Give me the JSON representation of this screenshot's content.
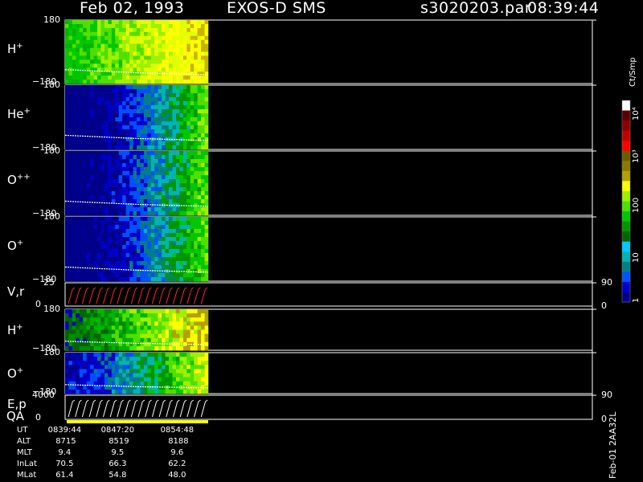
{
  "header": {
    "date": "Feb 02, 1993",
    "instrument": "EXOS-D SMS",
    "file": "s3020203.par",
    "time": "08:39:44"
  },
  "panels": [
    {
      "id": "p-hplus-1",
      "label": "H",
      "sup": "+",
      "ytop": "180",
      "ybot": "−180",
      "kind": "spec",
      "palette": "hplus"
    },
    {
      "id": "p-heplus",
      "label": "He",
      "sup": "+",
      "ytop": "180",
      "ybot": "−180",
      "kind": "spec",
      "palette": "cold"
    },
    {
      "id": "p-oplusplus",
      "label": "O",
      "sup": "++",
      "ytop": "180",
      "ybot": "−180",
      "kind": "spec",
      "palette": "cold"
    },
    {
      "id": "p-oplus-1",
      "label": "O",
      "sup": "+",
      "ytop": "180",
      "ybot": "−180",
      "kind": "spec",
      "palette": "cold"
    },
    {
      "id": "p-vr",
      "label": "V,r",
      "sup": "",
      "ytop": "25",
      "ybot": "0",
      "rtop": "90",
      "rbot": "0",
      "kind": "line",
      "color": "#ff2a2a"
    },
    {
      "id": "p-hplus-2",
      "label": "H",
      "sup": "+",
      "ytop": "180",
      "ybot": "−180",
      "kind": "spec",
      "palette": "hplus2"
    },
    {
      "id": "p-oplus-2",
      "label": "O",
      "sup": "+",
      "ytop": "180",
      "ybot": "−180",
      "kind": "spec",
      "palette": "cold2"
    },
    {
      "id": "p-ep",
      "label": "E,p",
      "sup": "",
      "ytop": "4000",
      "ybot": "0",
      "rtop": "90",
      "rbot": "0",
      "kind": "line",
      "color": "#ffffff"
    }
  ],
  "qa_label": "QA",
  "colorbar": {
    "title": "Ct/Smp",
    "ticks": [
      "1",
      "10",
      "100",
      "10³",
      "10⁴"
    ],
    "colors": [
      "#00008b",
      "#0000c8",
      "#0050ff",
      "#008080",
      "#00b4b4",
      "#00c8ff",
      "#006400",
      "#009600",
      "#00c800",
      "#50e000",
      "#a0f000",
      "#ffff00",
      "#b4a000",
      "#8c7800",
      "#6e5a00",
      "#ff0000",
      "#c00000",
      "#8b0000",
      "#5a0000",
      "#ffffff"
    ]
  },
  "ephemeris": {
    "rows": [
      {
        "label": "UT",
        "values": [
          "0839:44",
          "0847:20",
          "0854:48"
        ]
      },
      {
        "label": "ALT",
        "values": [
          "8715",
          "8519",
          "8188"
        ]
      },
      {
        "label": "MLT",
        "values": [
          "9.4",
          "9.5",
          "9.6"
        ]
      },
      {
        "label": "InLat",
        "values": [
          "70.5",
          "66.3",
          "62.2"
        ]
      },
      {
        "label": "MLat",
        "values": [
          "61.4",
          "54.8",
          "48.0"
        ]
      }
    ]
  },
  "side_label": "Feb-01 2AA32L",
  "chart_data": {
    "type": "heatmap",
    "title": "Feb 02, 1993   EXOS-D SMS",
    "x_time_labels": [
      "0839:44",
      "0847:20",
      "0854:48"
    ],
    "y_range_angle": [
      -180,
      180
    ],
    "color_scale": "log",
    "color_range": [
      1,
      10000
    ],
    "color_unit": "Ct/Smp",
    "series": [
      {
        "name": "H+",
        "kind": "spectrogram"
      },
      {
        "name": "He+",
        "kind": "spectrogram"
      },
      {
        "name": "O++",
        "kind": "spectrogram"
      },
      {
        "name": "O+",
        "kind": "spectrogram"
      },
      {
        "name": "V,r",
        "kind": "line",
        "ylim": [
          0,
          25
        ],
        "y2lim": [
          0,
          90
        ]
      },
      {
        "name": "H+",
        "kind": "spectrogram"
      },
      {
        "name": "O+",
        "kind": "spectrogram"
      },
      {
        "name": "E,p",
        "kind": "line",
        "ylim": [
          0,
          4000
        ],
        "y2lim": [
          0,
          90
        ]
      }
    ]
  }
}
